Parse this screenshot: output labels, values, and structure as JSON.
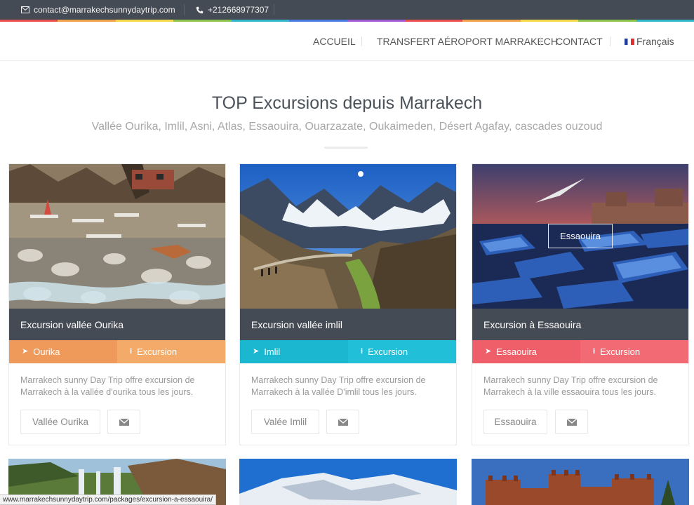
{
  "topbar": {
    "email": "contact@marrakechsunnydaytrip.com",
    "phone": "+212668977307",
    "email_icon": "envelope-icon",
    "phone_icon": "phone-icon",
    "rainbow_colors": [
      "#e94f4f",
      "#f0a24a",
      "#f3d94a",
      "#8bc34a",
      "#32b6c9",
      "#4a7be0",
      "#a05ad6",
      "#e94f4f",
      "#f0a24a",
      "#f3d94a",
      "#8bc34a",
      "#32b6c9"
    ]
  },
  "nav": {
    "items": [
      "ACCUEIL",
      "TRANSFERT AÉROPORT MARRAKECH",
      "CONTACT"
    ],
    "language": "Français",
    "language_icon": "french-flag-icon"
  },
  "hero": {
    "title": "TOP Excursions depuis Marrakech",
    "subtitle": "Vallée Ourika, Imlil, Asni, Atlas, Essaouira, Ouarzazate, Oukaimeden, Désert Agafay, cascades ouzoud"
  },
  "cards": [
    {
      "name": "Excursion vallée Ourika",
      "location": "Ourika",
      "type": "Excursion",
      "color_left": "#ef9a5b",
      "color_right": "#f4ab6a",
      "description": "Marrakech sunny Day Trip offre excursion de Marrakech à la vallée d'ourika tous les jours.",
      "button": "Vallée Ourika"
    },
    {
      "name": "Excursion vallée imlil",
      "location": "Imlil",
      "type": "Excursion",
      "color_left": "#1bb6cf",
      "color_right": "#22bfd8",
      "description": "Marrakech sunny Day Trip offre excursion de Marrakech à la vallée D'imlil tous les jours.",
      "button": "Valée Imlil"
    },
    {
      "name": "Excursion à Essaouira",
      "location": "Essaouira",
      "type": "Excursion",
      "color_left": "#ee5f69",
      "color_right": "#f26b74",
      "description": "Marrakech sunny Day Trip offre excursion de Marrakech à la ville essaouira tous les jours.",
      "button": "Essaouira",
      "image_label": "Essaouira"
    }
  ],
  "icons": {
    "location": "location-arrow-icon",
    "info": "info-icon",
    "mail": "envelope-icon"
  },
  "status_url": "www.marrakechsunnydaytrip.com/packages/excursion-a-essaouira/"
}
